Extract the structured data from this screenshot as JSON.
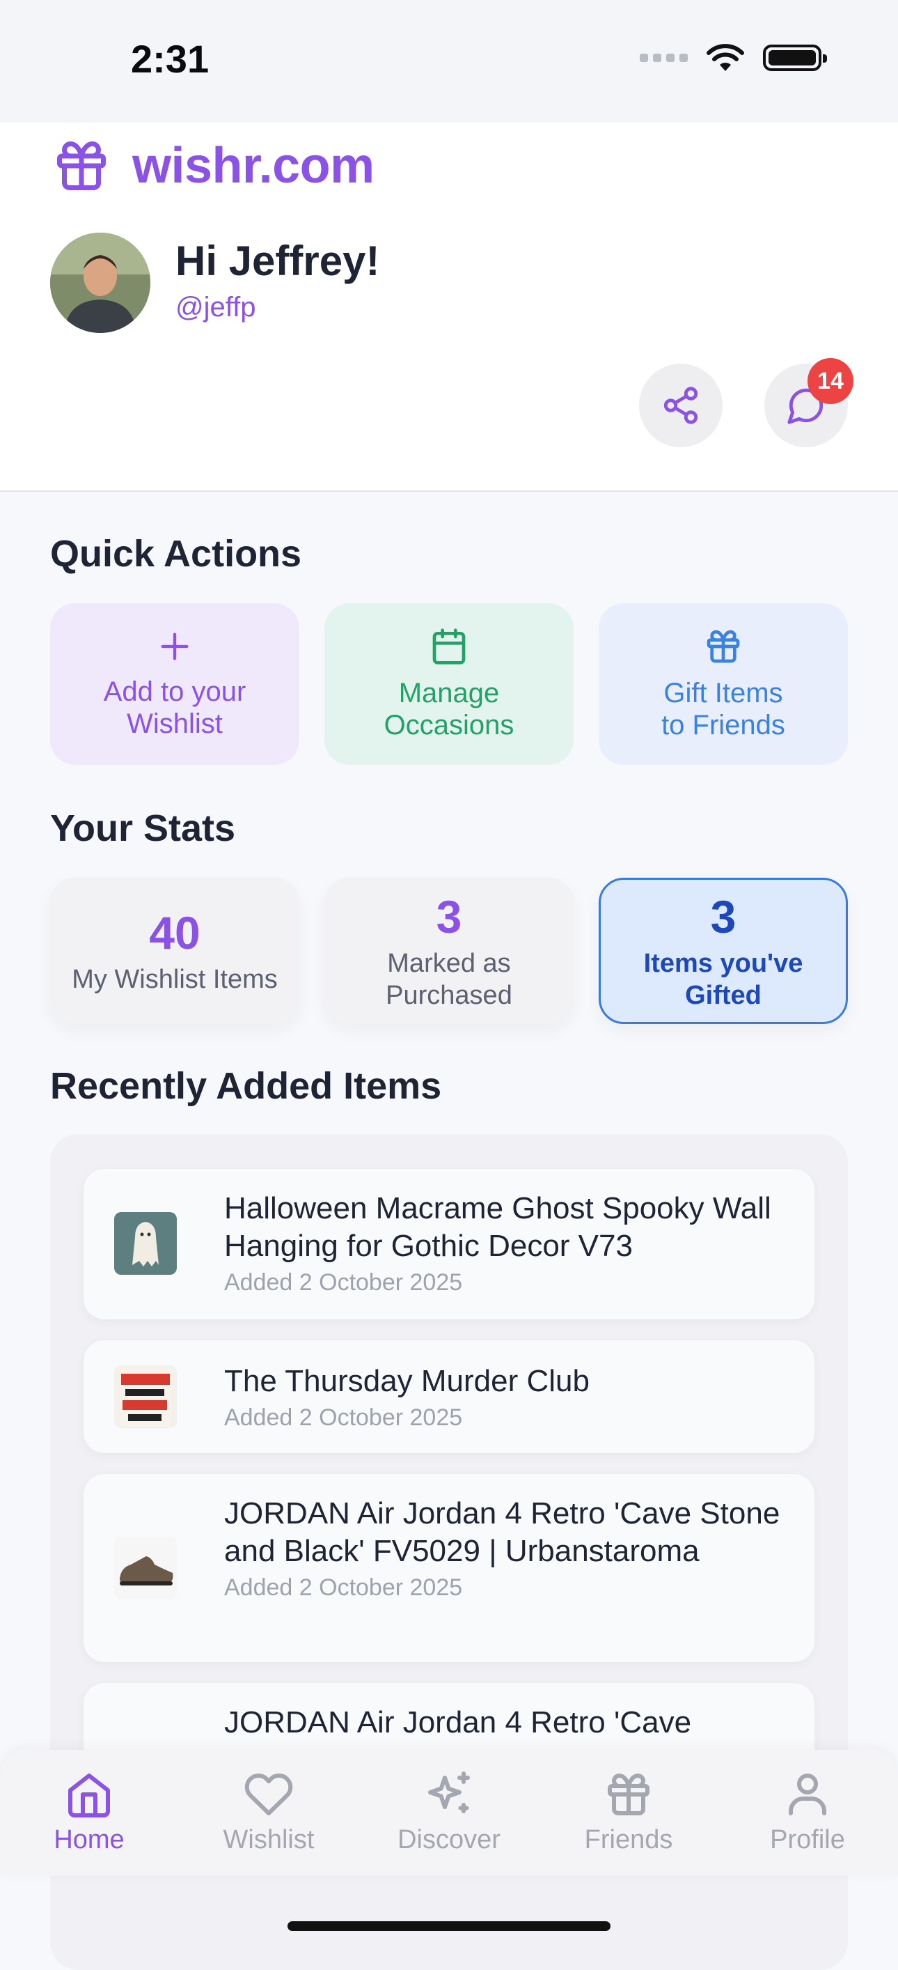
{
  "status_bar": {
    "time": "2:31"
  },
  "brand": {
    "name": "wishr.com"
  },
  "user": {
    "greeting": "Hi Jeffrey!",
    "handle": "@jeffp",
    "notification_count": "14"
  },
  "quick_actions": {
    "title": "Quick Actions",
    "items": [
      {
        "label": "Add to your\nWishlist",
        "icon": "plus-icon"
      },
      {
        "label": "Manage\nOccasions",
        "icon": "calendar-icon"
      },
      {
        "label": "Gift Items\nto Friends",
        "icon": "gift-icon"
      }
    ]
  },
  "stats": {
    "title": "Your Stats",
    "items": [
      {
        "value": "40",
        "label": "My Wishlist Items"
      },
      {
        "value": "3",
        "label": "Marked as\nPurchased"
      },
      {
        "value": "3",
        "label": "Items you've\nGifted"
      }
    ]
  },
  "recent": {
    "title": "Recently Added Items",
    "items": [
      {
        "title": "Halloween Macrame Ghost Spooky Wall Hanging for Gothic Decor V73",
        "date": "Added 2 October 2025"
      },
      {
        "title": "The Thursday Murder Club",
        "date": "Added 2 October 2025"
      },
      {
        "title": "JORDAN Air Jordan 4 Retro 'Cave Stone and Black' FV5029 | Urbanstaroma",
        "date": "Added 2 October 2025"
      },
      {
        "title": "JORDAN Air Jordan 4 Retro 'Cave",
        "date": ""
      }
    ]
  },
  "tabs": [
    {
      "label": "Home",
      "icon": "home-icon",
      "active": true
    },
    {
      "label": "Wishlist",
      "icon": "heart-icon"
    },
    {
      "label": "Discover",
      "icon": "sparkles-icon"
    },
    {
      "label": "Friends",
      "icon": "gift-icon"
    },
    {
      "label": "Profile",
      "icon": "user-icon"
    }
  ],
  "colors": {
    "accent": "#8b52e6",
    "green": "#22a267",
    "blue": "#3b82e0",
    "badge": "#ee4343"
  }
}
